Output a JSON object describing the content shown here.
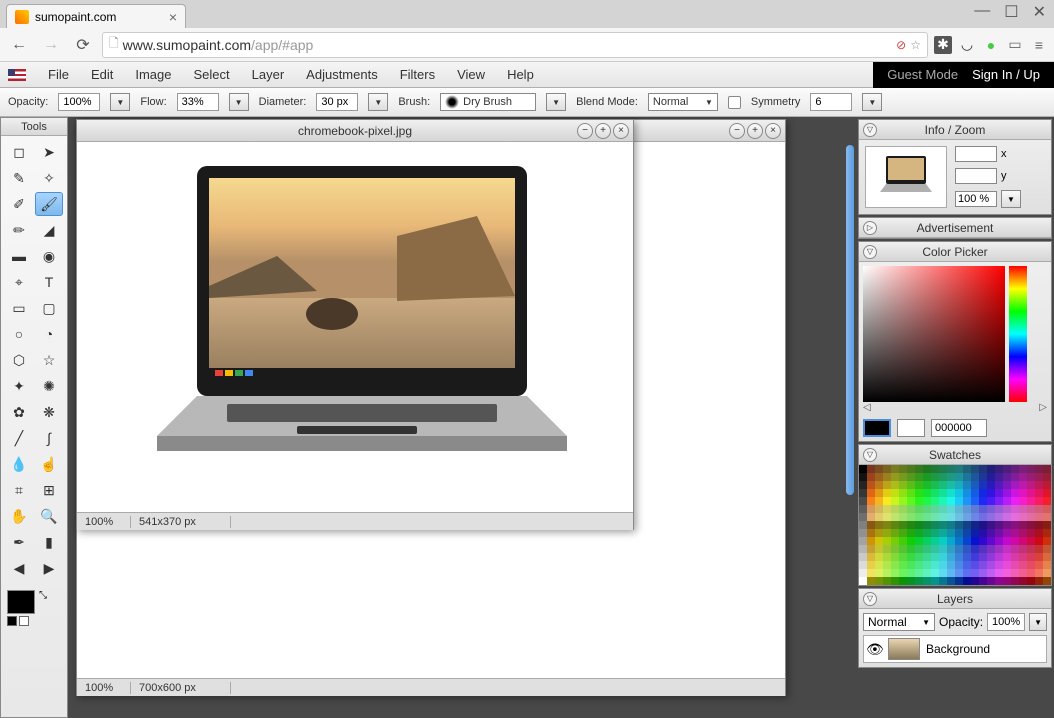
{
  "browser": {
    "tab_title": "sumopaint.com",
    "url_domain": "www.sumopaint.com",
    "url_path": "/app/#app"
  },
  "auth": {
    "guest": "Guest Mode",
    "signin": "Sign In / Up"
  },
  "menu": [
    "File",
    "Edit",
    "Image",
    "Select",
    "Layer",
    "Adjustments",
    "Filters",
    "View",
    "Help"
  ],
  "options": {
    "opacity_label": "Opacity:",
    "opacity_value": "100%",
    "flow_label": "Flow:",
    "flow_value": "33%",
    "diameter_label": "Diameter:",
    "diameter_value": "30 px",
    "brush_label": "Brush:",
    "brush_value": "Dry Brush",
    "blend_label": "Blend Mode:",
    "blend_value": "Normal",
    "symmetry_label": "Symmetry",
    "symmetry_value": "6"
  },
  "tools_title": "Tools",
  "doc1": {
    "title": "chromebook-pixel.jpg",
    "zoom": "100%",
    "dimensions": "541x370 px"
  },
  "doc2": {
    "zoom": "100%",
    "dimensions": "700x600 px"
  },
  "panels": {
    "info": {
      "title": "Info / Zoom",
      "x_label": "x",
      "y_label": "y",
      "zoom": "100 %"
    },
    "ad": {
      "title": "Advertisement"
    },
    "color": {
      "title": "Color Picker",
      "hex": "000000"
    },
    "swatches": {
      "title": "Swatches"
    },
    "layers": {
      "title": "Layers",
      "blend": "Normal",
      "opacity_label": "Opacity:",
      "opacity_value": "100%",
      "item": "Background"
    }
  }
}
